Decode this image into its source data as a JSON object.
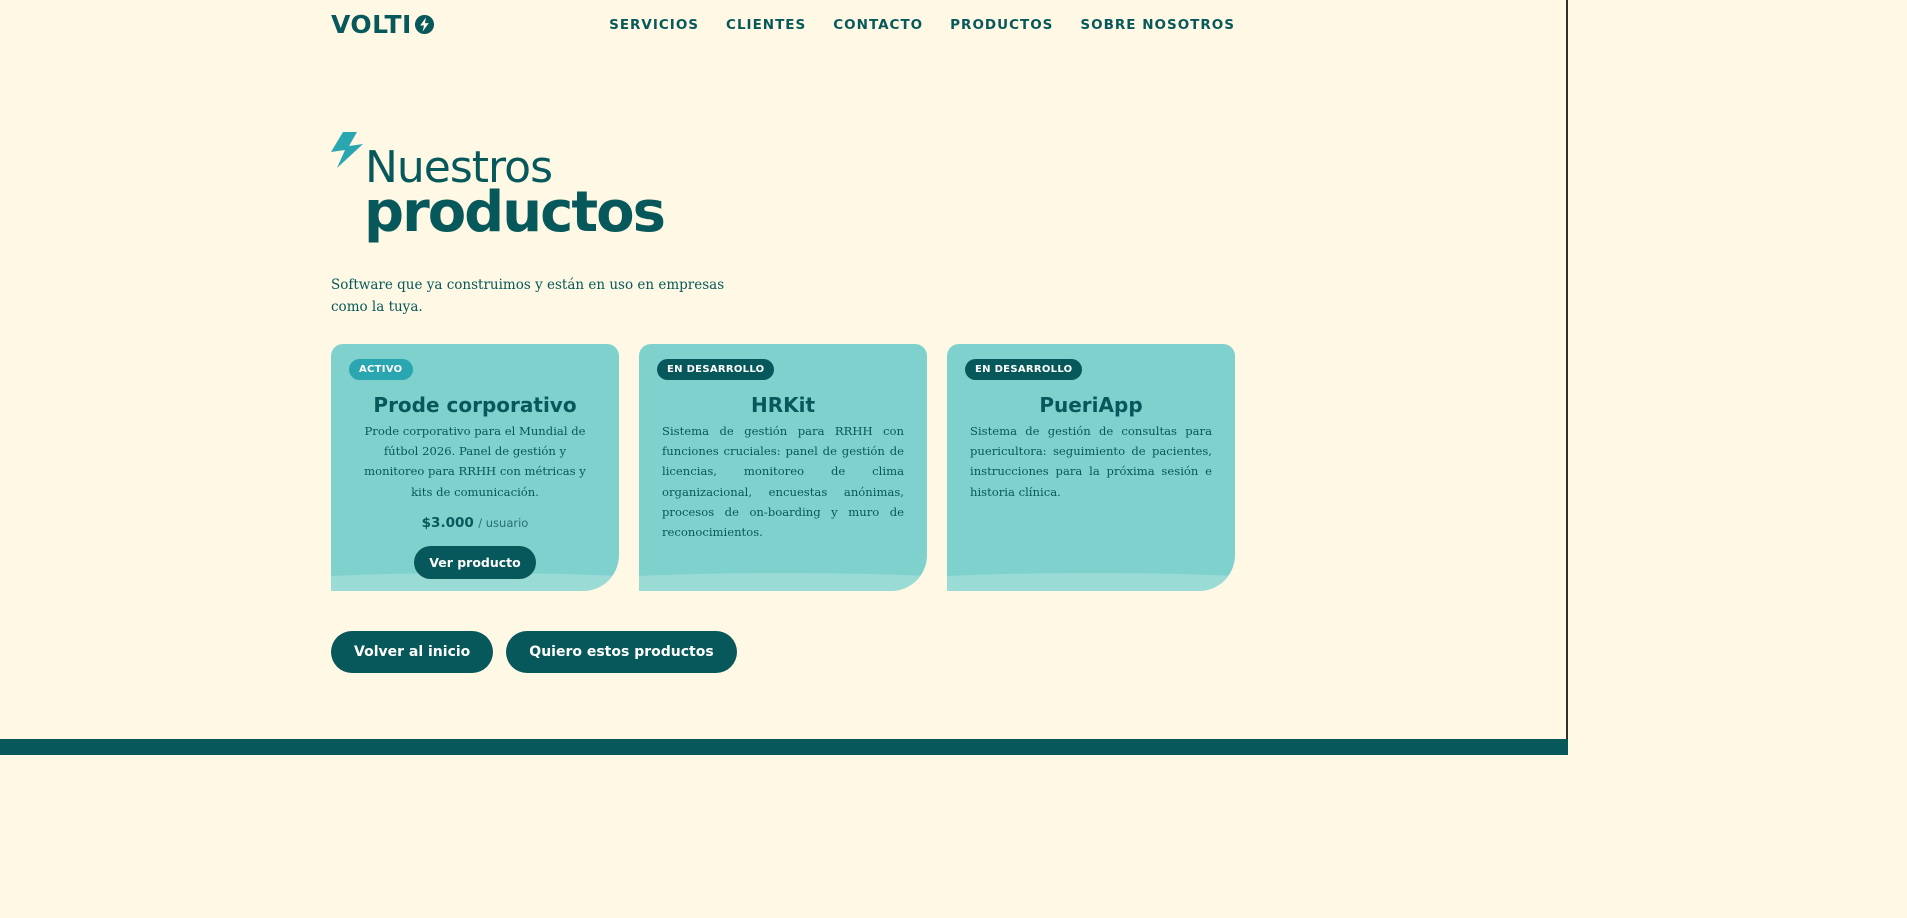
{
  "header": {
    "logo_text": "VOLTI",
    "logo_icon": "bolt-circle-icon",
    "nav": [
      {
        "label": "SERVICIOS"
      },
      {
        "label": "CLIENTES"
      },
      {
        "label": "CONTACTO"
      },
      {
        "label": "PRODUCTOS"
      },
      {
        "label": "SOBRE NOSOTROS"
      }
    ]
  },
  "hero": {
    "icon": "lightning-bolt-icon",
    "line1": "Nuestros",
    "line2": "productos",
    "subtitle": "Software que ya construimos y están en uso en empresas como la tuya."
  },
  "cards": [
    {
      "badge": "ACTIVO",
      "title": "Prode corporativo",
      "description": "Prode corporativo para el Mundial de fútbol 2026. Panel de gestión y monitoreo para RRHH con métricas y kits de comunicación.",
      "price": "$3.000",
      "price_unit": "/ usuario",
      "button": "Ver producto"
    },
    {
      "badge": "EN DESARROLLO",
      "title": "HRKit",
      "description": "Sistema de gestión para RRHH con funciones cruciales: panel de gestión de licencias, monitoreo de clima organizacional, encuestas anónimas, procesos de on-boarding y muro de reconocimientos."
    },
    {
      "badge": "EN DESARROLLO",
      "title": "PueriApp",
      "description": "Sistema de gestión de consultas para puericultora: seguimiento de pacientes, instrucciones para la próxima sesión e historia clínica."
    }
  ],
  "actions": {
    "back": "Volver al inicio",
    "want": "Quiero estos productos"
  },
  "colors": {
    "background": "#fef8e5",
    "primary": "#07585a",
    "card": "#7fd1cd",
    "accent": "#2aa6b0"
  }
}
